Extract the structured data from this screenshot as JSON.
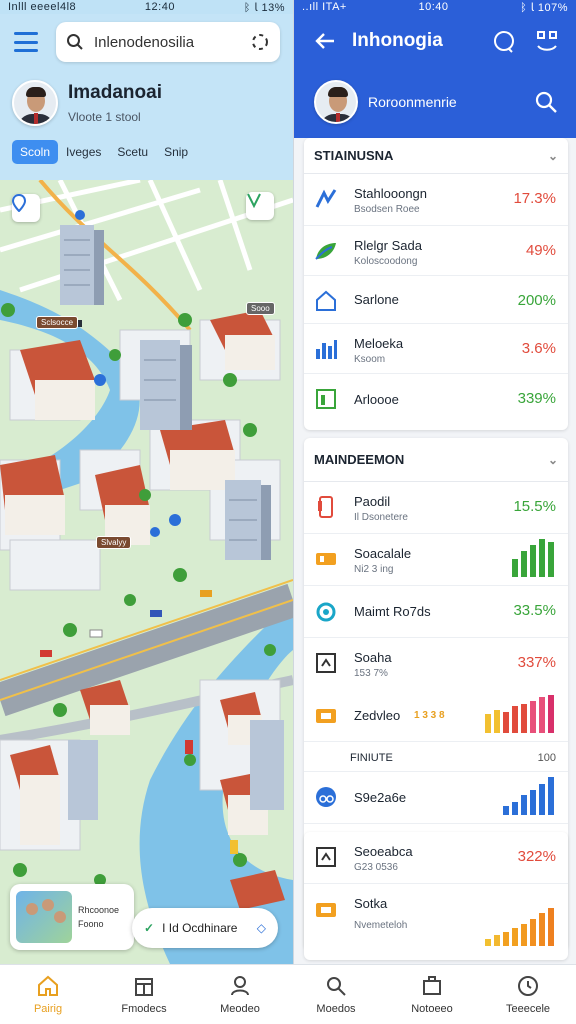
{
  "status": {
    "left_carrier": "Inlll eeeel4l8",
    "left_time": "12:40",
    "left_batt": "ᛒ 𝗅 13%",
    "right_carrier": "..ıll ITA+",
    "right_time": "10:40",
    "right_batt": "ᛒ 𝗅 107%"
  },
  "map_app": {
    "search_placeholder": "Inlenodenosilia",
    "profile_name": "Imadanoai",
    "profile_sub": "Vloote 1 stool",
    "chips": [
      "Scoln",
      "Iveges",
      "Scetu",
      "Snip"
    ],
    "tags": [
      "Sclsocce",
      "Sooo",
      "Slvalyy"
    ],
    "thumb_text": [
      "Rhcoonoe",
      "Foono"
    ],
    "location_pill": "I Id Ocdhinare"
  },
  "dash_app": {
    "title": "Inhonogia",
    "account": "Roroonmenrie",
    "section1": {
      "title": "STIAINUSNA",
      "rows": [
        {
          "title": "Stahlooongn",
          "sub": "Bsodsen Roee",
          "value": "17.3%",
          "color": "red"
        },
        {
          "title": "Rlelgr Sada",
          "sub": "Koloscoodong",
          "value": "49%",
          "color": "red"
        },
        {
          "title": "Sarlone",
          "sub": "",
          "value": "200%",
          "color": "green"
        },
        {
          "title": "Meloeka",
          "sub": "Ksoom",
          "value": "3.6%",
          "color": "red"
        },
        {
          "title": "Arloooe",
          "sub": "",
          "value": "339%",
          "color": "green"
        }
      ]
    },
    "section2": {
      "title": "MAINDEEMON",
      "rows": [
        {
          "title": "Paodil",
          "sub": "Il Dsonetere",
          "value": "15.5%",
          "color": "green"
        },
        {
          "title": "Soacalale",
          "sub": "Ni2 3 ing",
          "value": "",
          "color": "green"
        },
        {
          "title": "Maimt Ro7ds",
          "sub": "",
          "value": "33.5%",
          "color": "green"
        },
        {
          "title": "Soaha",
          "sub": "153 7%",
          "value": "337%",
          "color": "red"
        },
        {
          "title": "Zedvleo",
          "sub": "",
          "value": "",
          "color": "red"
        }
      ],
      "subsection": {
        "title": "FINIUTE",
        "right": "100"
      },
      "rows2": [
        {
          "title": "S9e2a6e",
          "sub": "",
          "value": "",
          "color": "blue"
        },
        {
          "title": "Seoeabca",
          "sub": "G23 0536",
          "value": "322%",
          "color": "red"
        },
        {
          "title": "Sotka",
          "sub": "Nvemeteloh",
          "value": "",
          "color": "orange"
        }
      ],
      "zedvleo_tag": "1 3 3 8"
    },
    "chart_bars": {
      "soacalale": [
        12,
        18,
        22,
        26,
        24
      ],
      "zedvleo": [
        20,
        24,
        22,
        28,
        30,
        34,
        38,
        40
      ],
      "s9e2a6e": [
        8,
        12,
        18,
        22,
        28,
        34
      ],
      "sotka": [
        10,
        16,
        20,
        26,
        32,
        40,
        48,
        56
      ]
    }
  },
  "bottom_nav": [
    {
      "label": "Pairig",
      "icon": "home-icon",
      "active": true
    },
    {
      "label": "Fmodecs",
      "icon": "calendar-icon",
      "active": false
    },
    {
      "label": "Meodeo",
      "icon": "person-icon",
      "active": false
    },
    {
      "label": "Moedos",
      "icon": "search-icon",
      "active": false
    },
    {
      "label": "Notoeeo",
      "icon": "briefcase-icon",
      "active": false
    },
    {
      "label": "Teeecele",
      "icon": "clock-icon",
      "active": false
    }
  ]
}
